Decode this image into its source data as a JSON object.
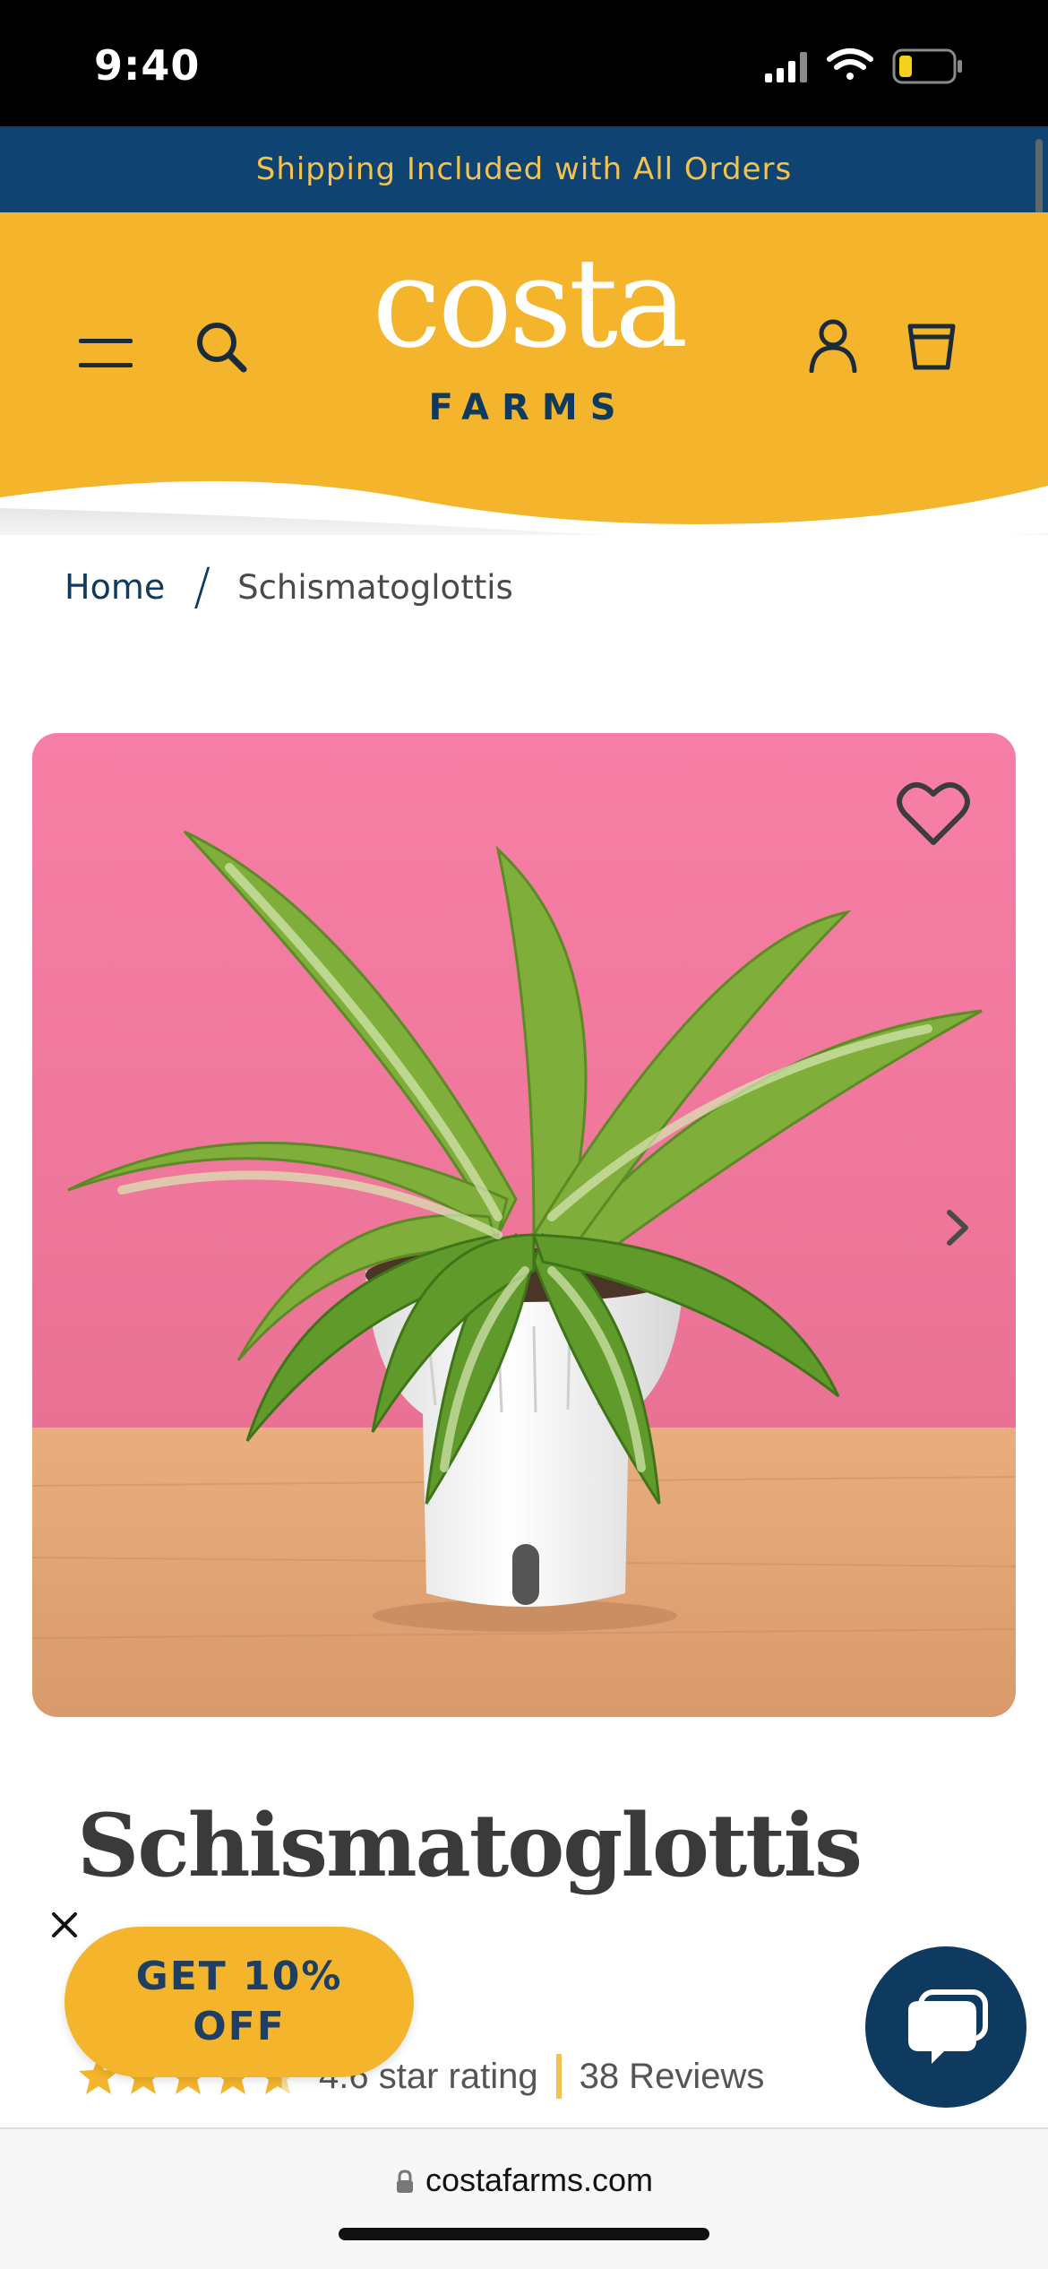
{
  "status_bar": {
    "time": "9:40",
    "icons": [
      "signal-icon",
      "wifi-icon",
      "battery-icon"
    ]
  },
  "promo": {
    "text": "Shipping Included with All Orders"
  },
  "header": {
    "logo_top": "costa",
    "logo_bottom": "FARMS",
    "icons": [
      "menu-icon",
      "search-icon",
      "account-icon",
      "cart-icon"
    ],
    "colors": {
      "header_bg": "#f4b52c",
      "navy": "#0f3a5f",
      "promo_bg": "#0f4472",
      "promo_text": "#f3c24f"
    }
  },
  "breadcrumb": {
    "home": "Home",
    "separator": "/",
    "current": "Schismatoglottis"
  },
  "product": {
    "image_alt": "Schismatoglottis plant in white pot",
    "image_icons": [
      "heart-icon",
      "chevron-right-icon"
    ],
    "title": "Schismatoglottis",
    "rating_value": 4.6,
    "rating_label": "4.6 star rating",
    "reviews": "38 Reviews"
  },
  "discount_popup": {
    "label": "GET 10% OFF"
  },
  "chat": {
    "icon": "chat-icon"
  },
  "browser": {
    "url": "costafarms.com"
  }
}
